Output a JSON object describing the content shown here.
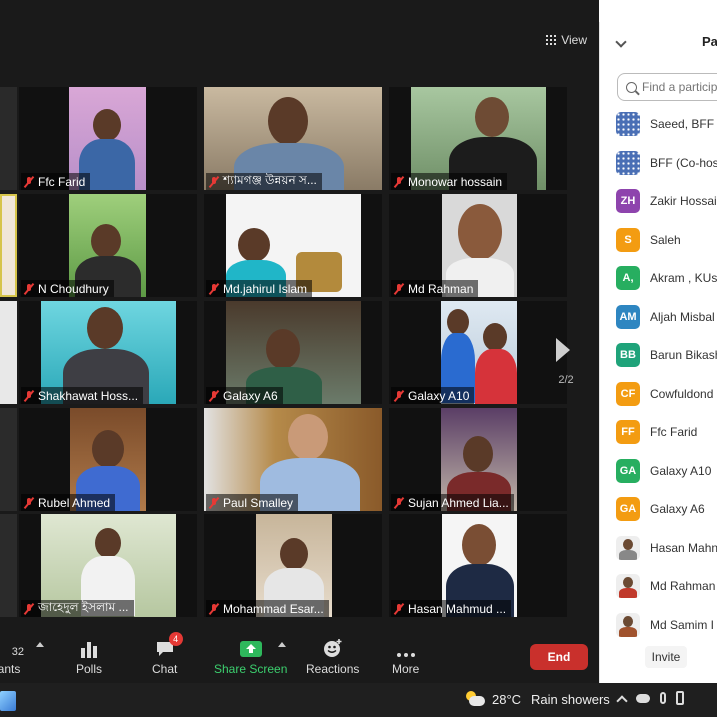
{
  "gallery": {
    "view_label": "View",
    "page_indicator": "2/2",
    "tiles": [
      {
        "name": "Ffc Farid"
      },
      {
        "name": "শ্যামগঞ্জ উন্নয়ন স..."
      },
      {
        "name": "Monowar hossain"
      },
      {
        "name": "N Choudhury"
      },
      {
        "name": "Md.jahirul Islam"
      },
      {
        "name": "Md Rahman"
      },
      {
        "name": "Shakhawat Hoss..."
      },
      {
        "name": "Galaxy A6"
      },
      {
        "name": "Galaxy A10"
      },
      {
        "name": "Rubel Ahmed"
      },
      {
        "name": "Paul Smalley"
      },
      {
        "name": "Sujan Ahmed Lia..."
      },
      {
        "name": "জাহেদুল ইসলাম ..."
      },
      {
        "name": "Mohammad Esar..."
      },
      {
        "name": "Hasan Mahmud ..."
      }
    ]
  },
  "toolbar": {
    "participants_count": "32",
    "participants_label": "ants",
    "polls_label": "Polls",
    "chat_label": "Chat",
    "chat_badge": "4",
    "share_label": "Share Screen",
    "reactions_label": "Reactions",
    "more_label": "More",
    "end_label": "End"
  },
  "panel": {
    "title": "Par",
    "search_placeholder": "Find a particip",
    "participants": [
      {
        "name": "Saeed, BFF (",
        "initials": "",
        "color": "#4a6fb5",
        "avatar": "pattern"
      },
      {
        "name": "BFF (Co-host",
        "initials": "",
        "color": "#4a6fb5",
        "avatar": "pattern"
      },
      {
        "name": "Zakir Hossai",
        "initials": "ZH",
        "color": "#8e44ad",
        "avatar": "initials"
      },
      {
        "name": "Saleh",
        "initials": "S",
        "color": "#f39c12",
        "avatar": "initials"
      },
      {
        "name": "Akram , KUs",
        "initials": "A,",
        "color": "#27ae60",
        "avatar": "initials"
      },
      {
        "name": "Aljah Misbal",
        "initials": "AM",
        "color": "#2e86c1",
        "avatar": "initials"
      },
      {
        "name": "Barun Bikash",
        "initials": "BB",
        "color": "#1fa37a",
        "avatar": "initials"
      },
      {
        "name": "Cowfuldond",
        "initials": "CF",
        "color": "#f39c12",
        "avatar": "initials"
      },
      {
        "name": "Ffc Farid",
        "initials": "FF",
        "color": "#f39c12",
        "avatar": "initials"
      },
      {
        "name": "Galaxy A10",
        "initials": "GA",
        "color": "#27ae60",
        "avatar": "initials"
      },
      {
        "name": "Galaxy A6",
        "initials": "GA",
        "color": "#f39c12",
        "avatar": "initials"
      },
      {
        "name": "Hasan Mahn",
        "initials": "",
        "color": "#888888",
        "avatar": "photo"
      },
      {
        "name": "Md Rahman",
        "initials": "",
        "color": "#c0392b",
        "avatar": "photo"
      },
      {
        "name": "Md Samim I",
        "initials": "",
        "color": "#a0522d",
        "avatar": "photo"
      }
    ],
    "invite_label": "Invite"
  },
  "taskbar": {
    "temperature": "28°C",
    "weather_text": "Rain showers"
  }
}
